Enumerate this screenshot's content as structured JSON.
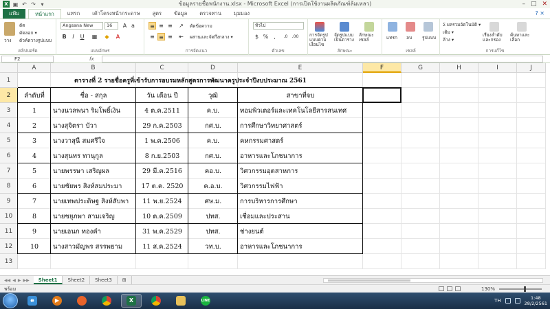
{
  "window": {
    "title": "ข้อมูลรายชื่อพนักงาน.xlsx - Microsoft Excel (การเปิดใช้งานผลิตภัณฑ์ล้มเหลว)",
    "minimize": "–",
    "maximize": "□",
    "close": "✕"
  },
  "ribbon": {
    "tabs": [
      "แฟ้ม",
      "หน้าแรก",
      "แทรก",
      "เค้าโครงหน้ากระดาษ",
      "สูตร",
      "ข้อมูล",
      "ตรวจทาน",
      "มุมมอง"
    ],
    "active_tab_index": 1,
    "help": "? ✕",
    "clipboard": {
      "paste": "วาง",
      "cut": "ตัด",
      "copy": "คัดลอก ▾",
      "format_painter": "ตัวคัดวางรูปแบบ",
      "label": "คลิปบอร์ด"
    },
    "font": {
      "name": "Angsana New",
      "size": "16",
      "bold": "B",
      "italic": "I",
      "underline": "U",
      "label": "แบบอักษร"
    },
    "alignment": {
      "wrap": "ตัดข้อความ",
      "merge": "ผสานและจัดกึ่งกลาง ▾",
      "label": "การจัดแนว"
    },
    "number": {
      "format": "ทั่วไป",
      "label": "ตัวเลข"
    },
    "styles": {
      "conditional": "การจัดรูปแบบตามเงื่อนไข",
      "as_table": "จัดรูปแบบเป็นตาราง",
      "cell_styles": "ลักษณะเซลล์",
      "label": "ลักษณะ"
    },
    "cells": {
      "insert": "แทรก",
      "delete": "ลบ",
      "format": "รูปแบบ",
      "label": "เซลล์"
    },
    "editing": {
      "autosum": "Σ ผลรวมอัตโนมัติ ▾",
      "fill": "เติม ▾",
      "clear": "ล้าง ▾",
      "sort": "เรียงลำดับและกรอง",
      "find": "ค้นหาและเลือก",
      "label": "การแก้ไข"
    }
  },
  "formula_bar": {
    "name_box": "F2",
    "fx": "fx",
    "value": ""
  },
  "columns": [
    "A",
    "B",
    "C",
    "D",
    "E",
    "F",
    "G",
    "H",
    "I",
    "J"
  ],
  "selected_column": "F",
  "rows": [
    "1",
    "2",
    "3",
    "4",
    "5",
    "6",
    "7",
    "8",
    "9",
    "10",
    "11",
    "12",
    "13"
  ],
  "selected_row": "2",
  "sheet": {
    "title": "ตารางที่ 2 รายชื่อครูที่เข้ารับการอบรมหลักสูตรการพัฒนาครูประจำปีงบประมาณ 2561",
    "headers": [
      "ลำดับที่",
      "ชื่อ - สกุล",
      "วัน เดือน ปี",
      "วุฒิ",
      "สาขาที่จบ"
    ],
    "records": [
      [
        "1",
        "นางนวลพนา ริมโพธิ์เงิน",
        "4 ต.ค.2511",
        "ค.บ.",
        "ทอมพิวเตอร์และเทคโนโลยีสารสนเทศ"
      ],
      [
        "2",
        "นางสุจิตรา บัวา",
        "29 ก.ค.2503",
        "กศ.บ.",
        "การศึกษาวิทยาศาสตร์"
      ],
      [
        "3",
        "นางวาสุนี สมศรีใจ",
        "1 พ.ค.2506",
        "ค.บ.",
        "คหกรรมศาสตร์"
      ],
      [
        "4",
        "นางสุนทร ทานุกูล",
        "8 ก.ย.2503",
        "กศ.บ.",
        "อาหารและโภชนาการ"
      ],
      [
        "5",
        "นายพรรษา เสริญผล",
        "29 มี.ค.2516",
        "คอ.บ.",
        "วิศวกรรมอุตสาหการ"
      ],
      [
        "6",
        "นายชัยพร สิงห์สมประมา",
        "17 ต.ค. 2520",
        "ค.อ.บ.",
        "วิศวกรรมไฟฟ้า"
      ],
      [
        "7",
        "นายเทพประดิษฐ สิงห์สับพา",
        "11 พ.ย.2524",
        "ศษ.ม.",
        "การบริหารการศึกษา"
      ],
      [
        "8",
        "นายชยุภพา สามเจริญ",
        "10 ต.ค.2509",
        "ปทส.",
        "เชื่อมและประสาน"
      ],
      [
        "9",
        "นายเอนก ทองคำ",
        "31 พ.ค.2529",
        "ปทส.",
        "ช่างยนต์"
      ],
      [
        "10",
        "นางสาวมัญพร สรรพยาม",
        "11 ส.ค.2524",
        "วท.บ.",
        "อาหารและโภชนาการ"
      ]
    ]
  },
  "sheet_tabs": [
    "Sheet1",
    "Sheet2",
    "Sheet3"
  ],
  "active_sheet": "Sheet1",
  "status": {
    "ready": "พร้อม",
    "zoom": "130%"
  },
  "taskbar": {
    "apps": [
      "explorer",
      "media-player",
      "firefox",
      "chrome",
      "excel",
      "chrome-alt",
      "folder",
      "line"
    ],
    "active_app": "excel",
    "lang": "TH",
    "time": "1:48",
    "date": "28/2/2561"
  },
  "colors": {
    "accent": "#1e7145",
    "selection": "#fde8a6"
  }
}
